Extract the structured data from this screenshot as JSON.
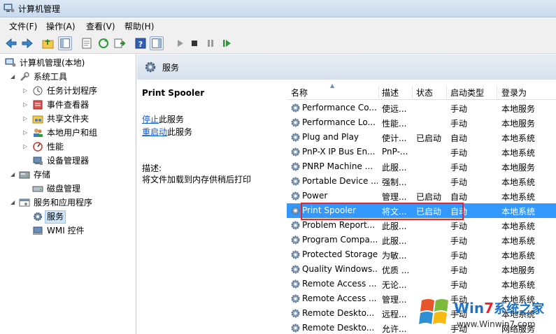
{
  "window": {
    "title": "计算机管理"
  },
  "menu": {
    "file": "文件(F)",
    "action": "操作(A)",
    "view": "查看(V)",
    "help": "帮助(H)"
  },
  "tree": {
    "root": "计算机管理(本地)",
    "system_tools": "系统工具",
    "task_scheduler": "任务计划程序",
    "event_viewer": "事件查看器",
    "shared_folders": "共享文件夹",
    "local_users": "本地用户和组",
    "performance": "性能",
    "device_manager": "设备管理器",
    "storage": "存储",
    "disk_management": "磁盘管理",
    "services_apps": "服务和应用程序",
    "services": "服务",
    "wmi": "WMI 控件"
  },
  "header": {
    "title": "服务"
  },
  "detail": {
    "service_name": "Print Spooler",
    "stop_link": "停止",
    "stop_suffix": "此服务",
    "restart_link": "重启动",
    "restart_suffix": "此服务",
    "desc_label": "描述:",
    "desc_text": "将文件加载到内存供稍后打印"
  },
  "table": {
    "headers": {
      "name": "名称",
      "desc": "描述",
      "status": "状态",
      "startup": "启动类型",
      "logon": "登录为"
    },
    "rows": [
      {
        "name": "Performance Co...",
        "desc": "使远...",
        "status": "",
        "startup": "手动",
        "logon": "本地服务"
      },
      {
        "name": "Performance Lo...",
        "desc": "性能...",
        "status": "",
        "startup": "手动",
        "logon": "本地服务"
      },
      {
        "name": "Plug and Play",
        "desc": "使计...",
        "status": "已启动",
        "startup": "自动",
        "logon": "本地系统"
      },
      {
        "name": "PnP-X IP Bus En...",
        "desc": "PnP-...",
        "status": "",
        "startup": "手动",
        "logon": "本地系统"
      },
      {
        "name": "PNRP Machine ...",
        "desc": "此服...",
        "status": "",
        "startup": "手动",
        "logon": "本地服务"
      },
      {
        "name": "Portable Device ...",
        "desc": "强制...",
        "status": "",
        "startup": "手动",
        "logon": "本地系统"
      },
      {
        "name": "Power",
        "desc": "管理...",
        "status": "已启动",
        "startup": "自动",
        "logon": "本地系统"
      },
      {
        "name": "Print Spooler",
        "desc": "将文...",
        "status": "已启动",
        "startup": "自动",
        "logon": "本地系统"
      },
      {
        "name": "Problem Report...",
        "desc": "此服...",
        "status": "",
        "startup": "手动",
        "logon": "本地系统"
      },
      {
        "name": "Program Compa...",
        "desc": "此服...",
        "status": "",
        "startup": "手动",
        "logon": "本地系统"
      },
      {
        "name": "Protected Storage",
        "desc": "为敏...",
        "status": "",
        "startup": "手动",
        "logon": "本地系统"
      },
      {
        "name": "Quality Windows...",
        "desc": "优质 ...",
        "status": "",
        "startup": "手动",
        "logon": "本地服务"
      },
      {
        "name": "Remote Access ...",
        "desc": "无论...",
        "status": "",
        "startup": "手动",
        "logon": "本地系统"
      },
      {
        "name": "Remote Access ...",
        "desc": "管理...",
        "status": "",
        "startup": "手动",
        "logon": "本地系统"
      },
      {
        "name": "Remote Deskto...",
        "desc": "远程...",
        "status": "",
        "startup": "手动",
        "logon": "本地系统"
      },
      {
        "name": "Remote Deskto...",
        "desc": "允许...",
        "status": "",
        "startup": "手动",
        "logon": "网络服务"
      }
    ]
  },
  "watermark": {
    "brand_left": "Win",
    "brand_digit": "7",
    "brand_right": "系统之家",
    "url": "www.Winwin7.com"
  },
  "colors": {
    "selection": "#3399ff",
    "highlight_box": "#e8252b",
    "link": "#0b5ad8"
  }
}
